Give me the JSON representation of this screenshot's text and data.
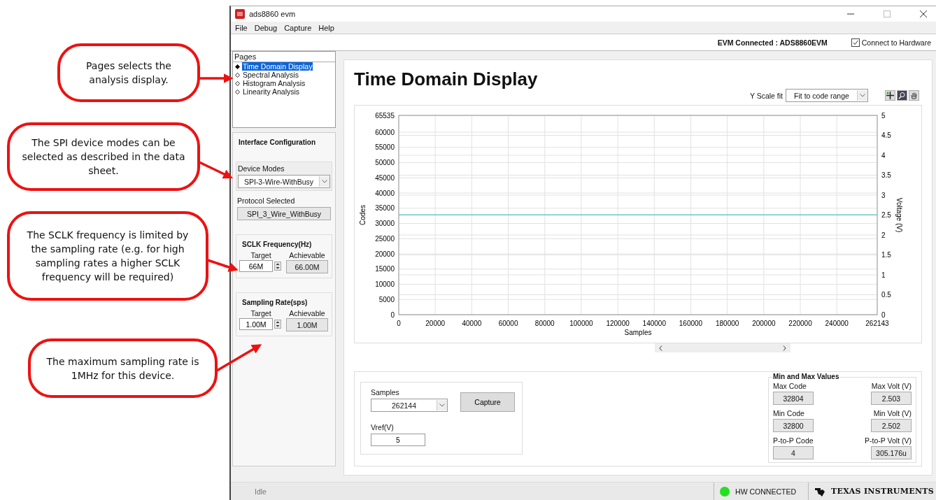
{
  "callouts": [
    {
      "text": "Pages selects the analysis display."
    },
    {
      "text": "The SPI device modes can be selected as described in the data sheet."
    },
    {
      "text": "The SCLK frequency is limited by the sampling rate (e.g. for high sampling rates a higher SCLK frequency will be required)"
    },
    {
      "text": "The maximum sampling rate is 1MHz for this device."
    }
  ],
  "window": {
    "title": "ads8860 evm"
  },
  "menu": [
    "File",
    "Debug",
    "Capture",
    "Help"
  ],
  "toolbar": {
    "status": "EVM Connected : ADS8860EVM",
    "connect": {
      "label": "Connect to Hardware",
      "checked": true
    }
  },
  "pages": {
    "title": "Pages",
    "items": [
      {
        "label": "Time Domain Display",
        "selected": true
      },
      {
        "label": "Spectral Analysis",
        "selected": false
      },
      {
        "label": "Histogram Analysis",
        "selected": false
      },
      {
        "label": "Linearity Analysis",
        "selected": false
      }
    ]
  },
  "interface": {
    "title": "Interface Configuration",
    "device_modes": {
      "label": "Device Modes",
      "value": "SPI-3-Wire-WithBusy"
    },
    "protocol": {
      "label": "Protocol Selected",
      "value": "SPI_3_Wire_WithBusy"
    },
    "groups": [
      {
        "title": "SCLK Frequency(Hz)",
        "target_label": "Target",
        "target": "66M",
        "achievable_label": "Achievable",
        "achievable": "66.00M"
      },
      {
        "title": "Sampling Rate(sps)",
        "target_label": "Target",
        "target": "1.00M",
        "achievable_label": "Achievable",
        "achievable": "1.00M"
      }
    ]
  },
  "main": {
    "title": "Time Domain Display",
    "y_scale": {
      "label": "Y Scale fit",
      "value": "Fit to code range"
    },
    "chart": {
      "chart_data": {
        "type": "line",
        "xlabel": "Samples",
        "ylabel": "Codes",
        "x": [
          0,
          262143
        ],
        "series": [
          {
            "color": "#6fc3c8",
            "values": [
              32800,
              32800
            ]
          }
        ],
        "grid": true,
        "xlim": [
          0,
          262143
        ],
        "ylim": [
          0,
          65535
        ],
        "xticks": [
          0,
          20000,
          40000,
          60000,
          80000,
          100000,
          120000,
          140000,
          160000,
          180000,
          200000,
          220000,
          240000,
          262143
        ],
        "yticks": [
          0,
          5000,
          10000,
          15000,
          20000,
          25000,
          30000,
          35000,
          40000,
          45000,
          50000,
          55000,
          60000,
          65535
        ]
      },
      "right_axis": {
        "label": "Voltage (V)",
        "ticks": [
          "5",
          "4.5",
          "4",
          "3.5",
          "3",
          "2.5",
          "2",
          "1.5",
          "1",
          "0.5",
          "0"
        ]
      }
    },
    "samples": {
      "label": "Samples",
      "value": "262144"
    },
    "capture": "Capture",
    "vref": {
      "label": "Vref(V)",
      "value": "5"
    },
    "min_max": {
      "title": "Min and Max Values",
      "items": [
        {
          "label": "Max Code",
          "value": "32804"
        },
        {
          "label": "Max Volt (V)",
          "value": "2.503"
        },
        {
          "label": "Min Code",
          "value": "32800"
        },
        {
          "label": "Min Volt (V)",
          "value": "2.502"
        },
        {
          "label": "P-to-P Code",
          "value": "4"
        },
        {
          "label": "P-to-P Volt (V)",
          "value": "305.176u"
        }
      ]
    }
  },
  "status_bar": {
    "state": "Idle",
    "hw": {
      "label": "HW CONNECTED",
      "color": "#22e022"
    },
    "logo": "TEXAS INSTRUMENTS"
  }
}
